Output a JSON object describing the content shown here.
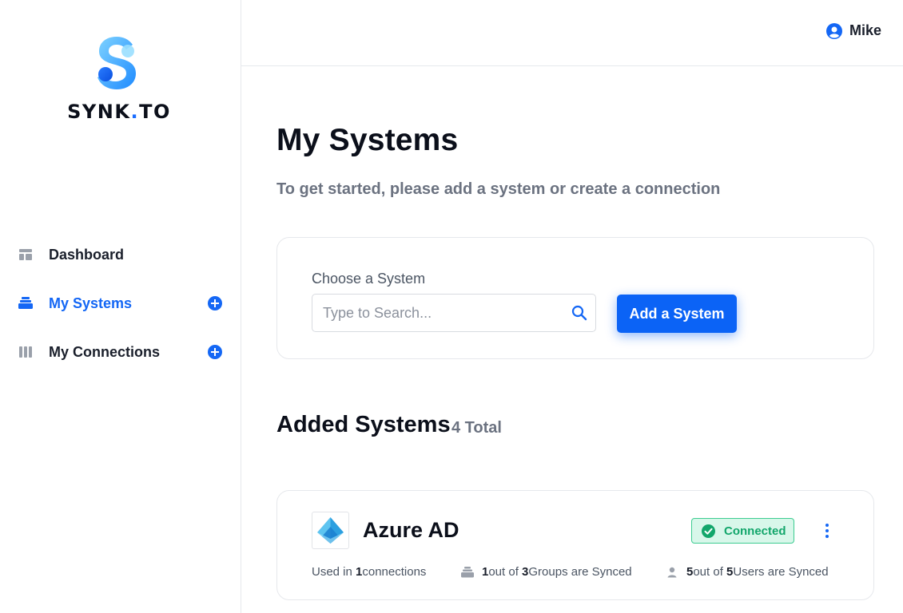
{
  "brand": {
    "name_main": "SYNK",
    "name_dot": ".",
    "name_end": "TO",
    "accent_color": "#1467f5"
  },
  "sidebar": {
    "items": [
      {
        "label": "Dashboard",
        "icon": "dashboard-icon",
        "active": false,
        "has_add": false
      },
      {
        "label": "My Systems",
        "icon": "stack-icon",
        "active": true,
        "has_add": true
      },
      {
        "label": "My Connections",
        "icon": "columns-icon",
        "active": false,
        "has_add": true
      }
    ]
  },
  "header": {
    "user_name": "Mike",
    "user_icon": "user-circle-icon"
  },
  "main": {
    "title": "My Systems",
    "subtitle": "To get started, please add a system or create a connection",
    "add_system": {
      "label": "Choose a System",
      "search_placeholder": "Type to Search...",
      "search_value": "",
      "button_label": "Add a System"
    },
    "added_systems": {
      "title": "Added Systems",
      "total": "4 Total",
      "items": [
        {
          "name": "Azure AD",
          "logo_icon": "azure-ad-icon",
          "status": "Connected",
          "status_color": "#12a66b",
          "meta_connections_pre": "Used in ",
          "meta_connections_count": "1",
          "meta_connections_post": " connections",
          "meta_groups_synced": "1",
          "meta_groups_mid": " out of ",
          "meta_groups_total": "3",
          "meta_groups_post": " Groups are Synced",
          "meta_users_synced": "5",
          "meta_users_mid": " out of ",
          "meta_users_total": "5",
          "meta_users_post": " Users are Synced"
        }
      ]
    }
  }
}
